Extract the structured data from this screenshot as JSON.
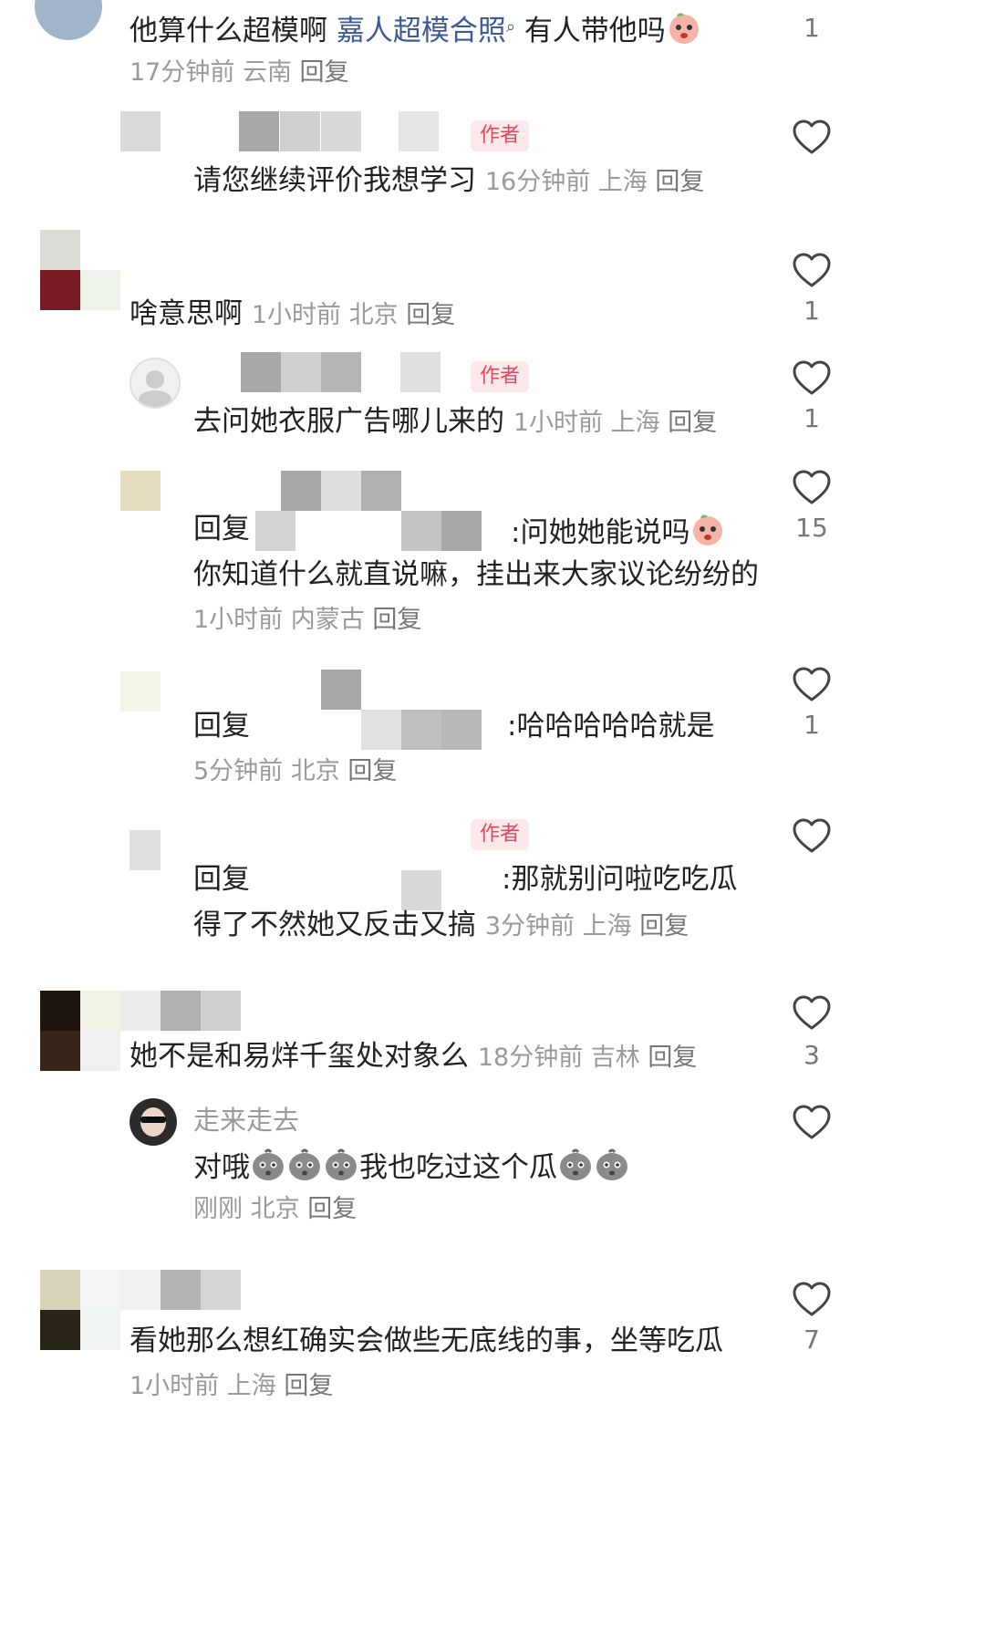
{
  "comments": [
    {
      "text_before": "他算什么超模啊",
      "link": "嘉人超模合照",
      "text_after": "有人带他吗",
      "meta": "17分钟前 云南",
      "reply": "回复",
      "likes": "1"
    },
    {
      "badge": "作者",
      "text": "请您继续评价我想学习",
      "meta": "16分钟前 上海",
      "reply": "回复"
    },
    {
      "text": "啥意思啊",
      "meta": "1小时前 北京",
      "reply": "回复",
      "likes": "1"
    },
    {
      "badge": "作者",
      "text": "去问她衣服广告哪儿来的",
      "meta": "1小时前 上海",
      "reply": "回复",
      "likes": "1"
    },
    {
      "prefix": "回复",
      "line1": ":问她她能说吗",
      "line2": "你知道什么就直说嘛，挂出来大家议论纷纷的",
      "meta": "1小时前 内蒙古",
      "reply": "回复",
      "likes": "15"
    },
    {
      "prefix": "回复",
      "line1": ":哈哈哈哈哈就是",
      "meta": "5分钟前 北京",
      "reply": "回复",
      "likes": "1"
    },
    {
      "badge": "作者",
      "prefix": "回复",
      "line1": ":那就别问啦吃吃瓜",
      "line2": "得了不然她又反击又搞",
      "meta": "3分钟前 上海",
      "reply": "回复"
    },
    {
      "text": "她不是和易烊千玺处对象么",
      "meta": "18分钟前 吉林",
      "reply": "回复",
      "likes": "3"
    },
    {
      "username": "走来走去",
      "text1": "对哦",
      "text2": "我也吃过这个瓜",
      "meta": "刚刚 北京",
      "reply": "回复"
    },
    {
      "text": "看她那么想红确实会做些无底线的事，坐等吃瓜",
      "meta": "1小时前 上海",
      "reply": "回复",
      "likes": "7"
    }
  ],
  "colors": {
    "author_badge": "#e8465d",
    "link": "#3c5a99",
    "meta": "#9a9a9a"
  }
}
